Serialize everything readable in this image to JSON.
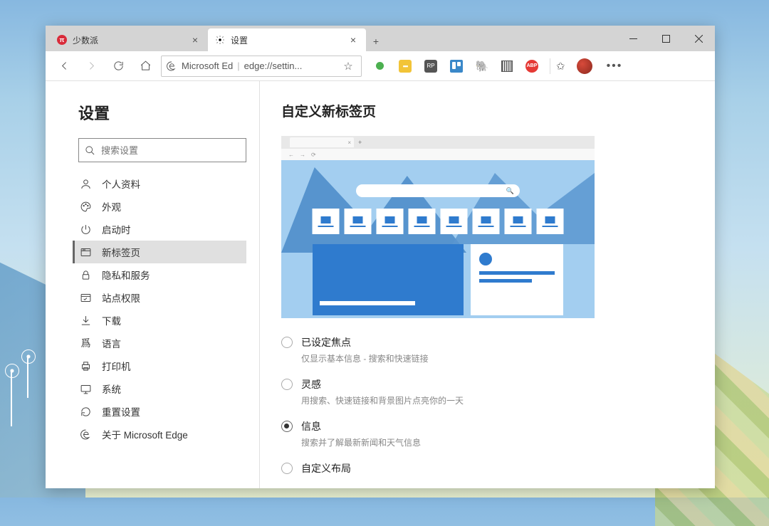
{
  "tabs": [
    {
      "title": "少数派",
      "close": "×"
    },
    {
      "title": "设置",
      "close": "×"
    }
  ],
  "toolbar": {
    "edge_label": "Microsoft Ed",
    "url": "edge://settin...",
    "abp_label": "ABP",
    "more": "•••"
  },
  "sidebar": {
    "title": "设置",
    "search_placeholder": "搜索设置",
    "items": [
      {
        "label": "个人资料"
      },
      {
        "label": "外观"
      },
      {
        "label": "启动时"
      },
      {
        "label": "新标签页"
      },
      {
        "label": "隐私和服务"
      },
      {
        "label": "站点权限"
      },
      {
        "label": "下载"
      },
      {
        "label": "语言"
      },
      {
        "label": "打印机"
      },
      {
        "label": "系统"
      },
      {
        "label": "重置设置"
      },
      {
        "label": "关于 Microsoft Edge"
      }
    ]
  },
  "main": {
    "title": "自定义新标签页",
    "options": [
      {
        "label": "已设定焦点",
        "desc": "仅显示基本信息 - 搜索和快速链接",
        "checked": false
      },
      {
        "label": "灵感",
        "desc": "用搜索、快速链接和背景图片点亮你的一天",
        "checked": false
      },
      {
        "label": "信息",
        "desc": "搜索并了解最新新闻和天气信息",
        "checked": true
      },
      {
        "label": "自定义布局",
        "desc": "",
        "checked": false
      }
    ]
  },
  "preview": {
    "tab_close": "×",
    "tab_plus": "+",
    "search_glyph": "🔍"
  }
}
